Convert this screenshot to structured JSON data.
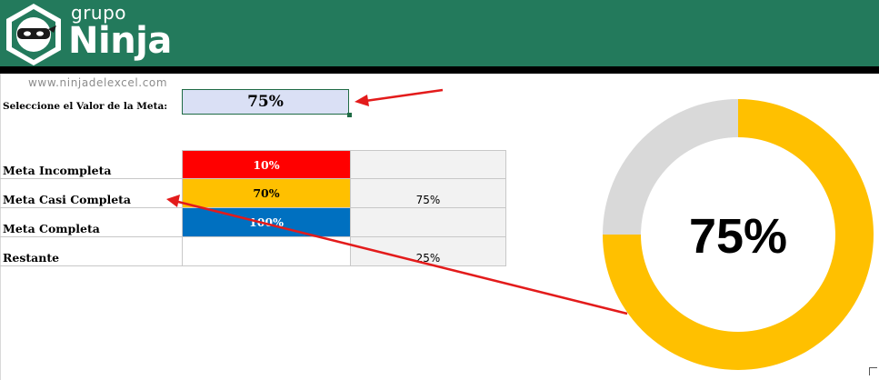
{
  "header": {
    "brand_small": "grupo",
    "brand_big": "Ninja",
    "logo_icon": "ninja-mask-icon",
    "bg_color": "#237a5c"
  },
  "website": "www.ninjadelexcel.com",
  "meta_input": {
    "label": "Seleccione el Valor de la Meta:",
    "value": "75%",
    "fill_color": "#dae0f5"
  },
  "table": {
    "rows": [
      {
        "label": "Meta Incompleta",
        "color_cell": "10%",
        "color": "#ff0000",
        "value": ""
      },
      {
        "label": "Meta Casi Completa",
        "color_cell": "70%",
        "color": "#ffc000",
        "value": "75%"
      },
      {
        "label": "Meta Completa",
        "color_cell": "100%",
        "color": "#0070c0",
        "value": ""
      },
      {
        "label": "Restante",
        "color_cell": "",
        "color": "#ffffff",
        "value": "25%"
      }
    ]
  },
  "chart_data": {
    "type": "pie",
    "style": "donut",
    "center_label": "75%",
    "slices": [
      {
        "name": "Meta",
        "value": 75,
        "color": "#ffc000"
      },
      {
        "name": "Restante",
        "value": 25,
        "color": "#d9d9d9"
      }
    ],
    "start_angle_deg": 0,
    "direction": "clockwise"
  }
}
